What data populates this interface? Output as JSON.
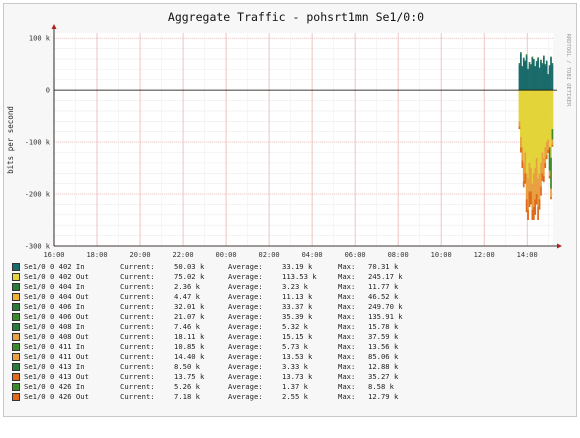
{
  "chart_data": {
    "type": "area",
    "title": "Aggregate Traffic - pohsrt1mn Se1/0:0",
    "ylabel": "bits per second",
    "watermark": "RRDTOOL / TOBI OETIKER",
    "ylim": [
      -300000,
      110000
    ],
    "y_ticks": [
      100000,
      0,
      -100000,
      -200000,
      -300000
    ],
    "y_tick_labels": [
      "100 k",
      "0",
      "-100 k",
      "-200 k",
      "-300 k"
    ],
    "x_tick_labels": [
      "16:00",
      "18:00",
      "20:00",
      "22:00",
      "00:00",
      "02:00",
      "04:00",
      "06:00",
      "08:00",
      "10:00",
      "12:00",
      "14:00"
    ],
    "x_tick_hours": [
      0,
      2,
      4,
      6,
      8,
      10,
      12,
      14,
      16,
      18,
      20,
      22
    ],
    "x_range_hours": [
      0,
      23.2
    ],
    "data_start_hour": 21.6,
    "grid": true,
    "area_series": [
      {
        "name": "Se1/0 0 402 In",
        "color": "#1a6b6b",
        "direction": "in",
        "values": [
          50000,
          70000,
          45000,
          60000,
          55000,
          66000,
          40000,
          52000,
          48000,
          62000,
          58000,
          45000,
          54000,
          60000,
          42000,
          56000,
          50000,
          64000,
          48000,
          55000,
          30000,
          46000,
          62000,
          50000
        ]
      },
      {
        "name": "Se1/0 0 404 In",
        "color": "#2a7a3a",
        "direction": "in",
        "values": [
          2000,
          3000,
          1500,
          2500,
          2000,
          3000,
          1000,
          2000,
          2000,
          2500,
          2000,
          1500,
          2000,
          3000,
          1500,
          2500,
          2000,
          2500,
          2000,
          2000,
          1000,
          2000,
          2500,
          2000
        ]
      },
      {
        "name": "Se1/0 0 402 Out",
        "color": "#e3d43a",
        "direction": "out",
        "values": [
          60000,
          90000,
          110000,
          140000,
          120000,
          160000,
          170000,
          140000,
          150000,
          180000,
          160000,
          150000,
          130000,
          170000,
          160000,
          140000,
          120000,
          130000,
          110000,
          100000,
          95000,
          110000,
          130000,
          75000
        ]
      },
      {
        "name": "Se1/0 0 406 Out",
        "color": "#3a8a2a",
        "direction": "out",
        "values": [
          0,
          0,
          0,
          0,
          0,
          0,
          0,
          0,
          0,
          0,
          0,
          0,
          0,
          0,
          0,
          0,
          0,
          0,
          0,
          0,
          0,
          45000,
          60000,
          20000
        ]
      },
      {
        "name": "Se1/0 0 411 Out",
        "color": "#e8a040",
        "direction": "out",
        "values": [
          10000,
          20000,
          25000,
          35000,
          40000,
          50000,
          60000,
          55000,
          45000,
          50000,
          65000,
          60000,
          70000,
          55000,
          50000,
          45000,
          40000,
          35000,
          30000,
          25000,
          20000,
          10000,
          15000,
          10000
        ]
      },
      {
        "name": "Se1/0 0 413 Out",
        "color": "#e06a1a",
        "direction": "out",
        "values": [
          5000,
          10000,
          15000,
          12000,
          20000,
          25000,
          20000,
          30000,
          25000,
          20000,
          25000,
          30000,
          20000,
          25000,
          20000,
          18000,
          15000,
          12000,
          10000,
          8000,
          6000,
          5000,
          5000,
          4000
        ]
      }
    ],
    "legend": [
      {
        "name": "Se1/0 0 402 In",
        "color": "#1a6b6b",
        "current": "50.03 k",
        "average": "33.19 k",
        "max": "70.31 k"
      },
      {
        "name": "Se1/0 0 402 Out",
        "color": "#e3d43a",
        "current": "75.02 k",
        "average": "113.53 k",
        "max": "245.17 k"
      },
      {
        "name": "Se1/0 0 404 In",
        "color": "#2a7a3a",
        "current": "2.36 k",
        "average": "3.23 k",
        "max": "11.77 k"
      },
      {
        "name": "Se1/0 0 404 Out",
        "color": "#f0b030",
        "current": "4.47 k",
        "average": "11.13 k",
        "max": "46.52 k"
      },
      {
        "name": "Se1/0 0 406 In",
        "color": "#2a7a3a",
        "current": "32.01 k",
        "average": "33.37 k",
        "max": "249.70 k"
      },
      {
        "name": "Se1/0 0 406 Out",
        "color": "#3a8a2a",
        "current": "21.07 k",
        "average": "35.39 k",
        "max": "135.91 k"
      },
      {
        "name": "Se1/0 0 408 In",
        "color": "#2a7a3a",
        "current": "7.46 k",
        "average": "5.32 k",
        "max": "15.78 k"
      },
      {
        "name": "Se1/0 0 408 Out",
        "color": "#e8a040",
        "current": "18.11 k",
        "average": "15.15 k",
        "max": "37.59 k"
      },
      {
        "name": "Se1/0 0 411 In",
        "color": "#3a8a2a",
        "current": "10.85 k",
        "average": "5.73 k",
        "max": "13.56 k"
      },
      {
        "name": "Se1/0 0 411 Out",
        "color": "#e8a040",
        "current": "14.40 k",
        "average": "13.53 k",
        "max": "85.06 k"
      },
      {
        "name": "Se1/0 0 413 In",
        "color": "#2a7a3a",
        "current": "8.50 k",
        "average": "3.33 k",
        "max": "12.88 k"
      },
      {
        "name": "Se1/0 0 413 Out",
        "color": "#e06a1a",
        "current": "13.75 k",
        "average": "13.73 k",
        "max": "35.27 k"
      },
      {
        "name": "Se1/0 0 426 In",
        "color": "#3a8a2a",
        "current": "5.26 k",
        "average": "1.37 k",
        "max": "8.58 k"
      },
      {
        "name": "Se1/0 0 426 Out",
        "color": "#e06a1a",
        "current": "7.18 k",
        "average": "2.55 k",
        "max": "12.79 k"
      }
    ],
    "legend_labels": {
      "current": "Current:",
      "average": "Average:",
      "max": "Max:"
    }
  }
}
